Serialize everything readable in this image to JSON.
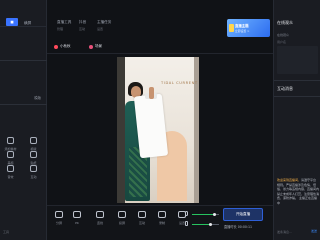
{
  "left": {
    "top_text": "横屏",
    "logo": "■",
    "side_label": "模版",
    "tools": [
      {
        "label": "添加素材",
        "icon": "add-icon"
      },
      {
        "label": "模版",
        "icon": "template-icon"
      },
      {
        "label": "美颜",
        "icon": "beauty-icon"
      },
      {
        "label": "贴纸",
        "icon": "sticker-icon"
      },
      {
        "label": "音效",
        "icon": "sound-icon"
      },
      {
        "label": "互动",
        "icon": "interact-icon"
      }
    ],
    "bottom": "工具"
  },
  "tabs": [
    {
      "label": "直播工具",
      "sub": "管理"
    },
    {
      "label": "抖音",
      "sub": "互动"
    },
    {
      "label": "主播任务",
      "sub": "设置"
    }
  ],
  "banner": {
    "title": "直播主题",
    "subtitle": "立即设置 >"
  },
  "scenes": [
    {
      "label": "小秋秋",
      "dot": "red"
    },
    {
      "label": "场景",
      "dot": "pink"
    }
  ],
  "video": {
    "brand_text": "TIDAL CURRENT"
  },
  "toolbar": {
    "buttons": [
      {
        "label": "分屏",
        "icon": "split-icon"
      },
      {
        "label": "PK",
        "icon": "pk-icon"
      },
      {
        "label": "连线",
        "icon": "link-icon"
      },
      {
        "label": "投屏",
        "icon": "cast-icon"
      },
      {
        "label": "互动",
        "icon": "chat-icon"
      },
      {
        "label": "录制",
        "icon": "record-icon"
      },
      {
        "label": "设置",
        "icon": "gear-icon"
      }
    ],
    "mic_level": 0.85,
    "speaker_level": 0.7,
    "start_label": "开始直播",
    "timer": "直播时长 00:00:11"
  },
  "right": {
    "section1_title": "在线观众",
    "section1_sub": "在线观众",
    "section1_sub2": "用户名",
    "section2_title": "互动消息",
    "message_prefix": "欢迎来到直播间，",
    "message_body": "请遵守平台规则。严禁直播涉及色情、低俗、暴力等违规内容，直播间内禁止未成年人打赏，注意理性消费，谨防诈骗。",
    "message_tail": "主播正在直播中",
    "footer": "发条消息...",
    "footer_btn": "发送"
  }
}
